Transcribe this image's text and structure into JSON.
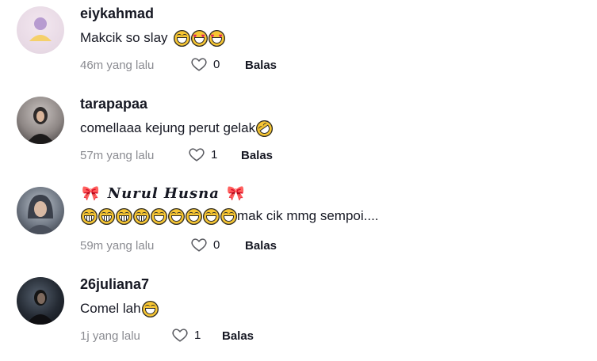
{
  "comments": [
    {
      "username": "eiykahmad",
      "text": "Makcik so slay",
      "emojis": [
        "laughing-tears",
        "heart-eyes",
        "heart-eyes"
      ],
      "time": "46m yang lalu",
      "likes": "0",
      "reply_label": "Balas"
    },
    {
      "username": "tarapapaa",
      "text": "comellaaa kejung perut gelak",
      "emojis": [
        "rolling-laughing"
      ],
      "time": "57m yang lalu",
      "likes": "1",
      "reply_label": "Balas"
    },
    {
      "username": "Nurul Husna",
      "username_decoration": "ribbon",
      "emojis_before_text": [
        "grinning",
        "grinning",
        "grinning",
        "grinning",
        "laughing-tears",
        "laughing-tears",
        "laughing-tears",
        "laughing-tears",
        "laughing-tears"
      ],
      "text": "mak cik mmg sempoi....",
      "time": "59m yang lalu",
      "likes": "0",
      "reply_label": "Balas"
    },
    {
      "username": "26juliana7",
      "text": "Comel lah",
      "emojis": [
        "laughing-tears"
      ],
      "time": "1j yang lalu",
      "likes": "1",
      "reply_label": "Balas"
    }
  ],
  "colors": {
    "text": "#161823",
    "muted": "#8a8b91",
    "background": "#ffffff"
  },
  "icons": {
    "like": "heart-outline-icon",
    "ribbon": "ribbon-emoji"
  }
}
